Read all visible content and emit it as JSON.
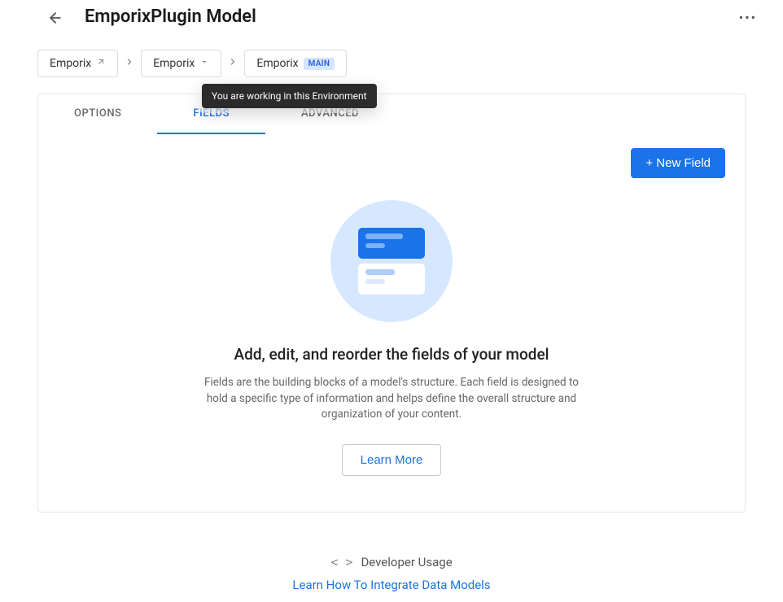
{
  "header": {
    "title": "EmporixPlugin Model"
  },
  "breadcrumbs": {
    "items": [
      {
        "label": "Emporix",
        "icon": "external"
      },
      {
        "label": "Emporix",
        "icon": "chevron-down"
      },
      {
        "label": "Emporix",
        "badge": "MAIN"
      }
    ],
    "tooltip": "You are working in this Environment"
  },
  "tabs": {
    "options": "OPTIONS",
    "fields": "FIELDS",
    "advanced": "ADVANCED",
    "active": "fields"
  },
  "actions": {
    "new_field": "+ New Field"
  },
  "empty_state": {
    "title": "Add, edit, and reorder the fields of your model",
    "description": "Fields are the building blocks of a model's structure. Each field is designed to hold a specific type of information and helps define the overall structure and organization of your content.",
    "learn_more": "Learn More"
  },
  "developer": {
    "title": "Developer Usage",
    "link": "Learn How To Integrate Data Models"
  }
}
